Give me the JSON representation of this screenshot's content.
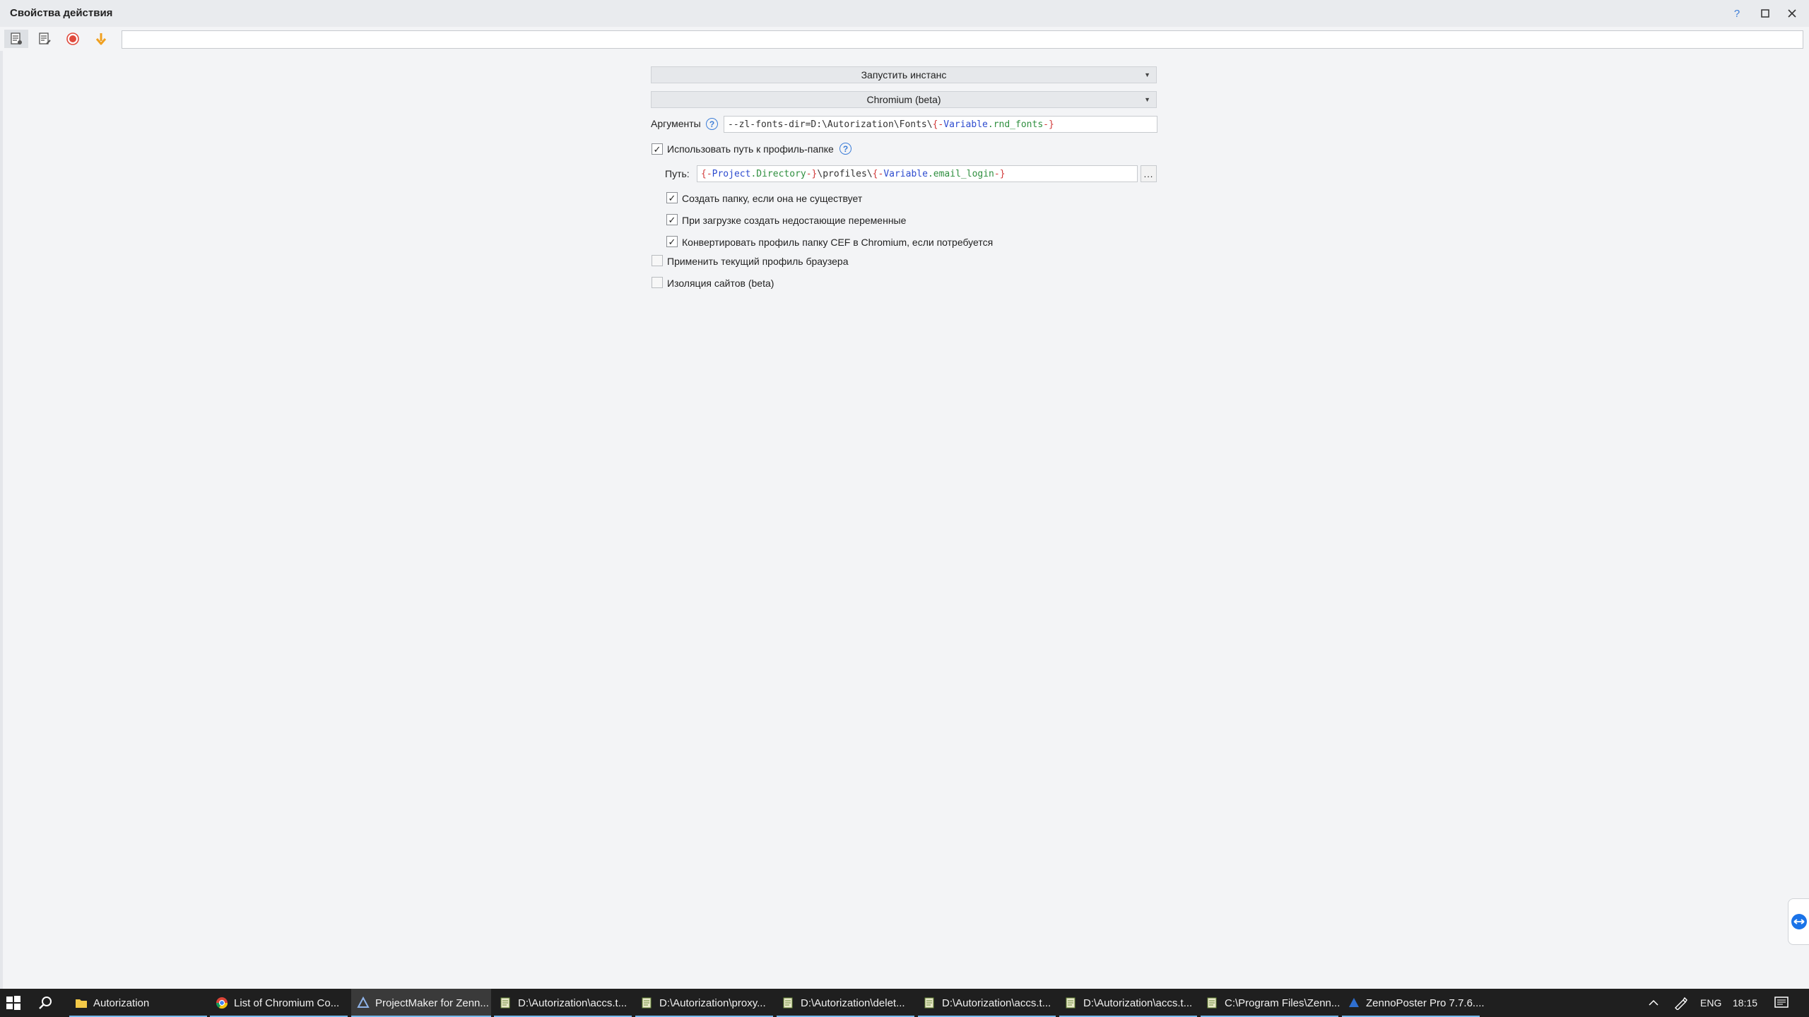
{
  "window": {
    "title": "Свойства действия",
    "help_glyph": "?"
  },
  "toolbar": {
    "search_value": ""
  },
  "form": {
    "action_dropdown": "Запустить инстанс",
    "browser_dropdown": "Chromium (beta)",
    "arguments_label": "Аргументы",
    "arguments_tokens": [
      "--zl-fonts-dir=D:\\Autorization\\Fonts\\",
      "{-",
      "Variable",
      ".rnd_fonts",
      "-}"
    ],
    "use_profile_label": "Использовать путь к профиль-папке",
    "use_profile_checked": true,
    "path_label": "Путь:",
    "path_tokens": [
      "{-",
      "Project",
      ".Directory",
      "-}",
      "\\profiles\\",
      "{-",
      "Variable",
      ".email_login",
      "-}"
    ],
    "browse_label": "...",
    "sub_options": [
      {
        "label": "Создать папку, если она не существует",
        "checked": true
      },
      {
        "label": "При загрузке создать недостающие переменные",
        "checked": true
      },
      {
        "label": "Конвертировать профиль папку CEF в Chromium, если потребуется",
        "checked": true
      }
    ],
    "options": [
      {
        "label": "Применить текущий профиль браузера",
        "checked": false
      },
      {
        "label": "Изоляция сайтов (beta)",
        "checked": false
      }
    ]
  },
  "taskbar": {
    "items": [
      {
        "label": "Autorization",
        "icon": "folder-icon"
      },
      {
        "label": "List of Chromium Co...",
        "icon": "chrome-icon"
      },
      {
        "label": "ProjectMaker for Zenn...",
        "icon": "projectmaker-icon"
      },
      {
        "label": "D:\\Autorization\\accs.t...",
        "icon": "notepad-icon"
      },
      {
        "label": "D:\\Autorization\\proxy...",
        "icon": "notepad-icon"
      },
      {
        "label": "D:\\Autorization\\delet...",
        "icon": "notepad-icon"
      },
      {
        "label": "D:\\Autorization\\accs.t...",
        "icon": "notepad-icon"
      },
      {
        "label": "D:\\Autorization\\accs.t...",
        "icon": "notepad-icon"
      },
      {
        "label": "C:\\Program Files\\Zenn...",
        "icon": "notepad-icon"
      },
      {
        "label": "ZennoPoster Pro 7.7.6....",
        "icon": "zennoposter-icon"
      }
    ],
    "language": "ENG",
    "clock": "18:15"
  },
  "colors": {
    "accent": "#3d7ed8",
    "token_red": "#d23a3a",
    "token_blue": "#2d4bcf",
    "token_green": "#2f8f3f",
    "taskbar": "#1f1f1f"
  }
}
